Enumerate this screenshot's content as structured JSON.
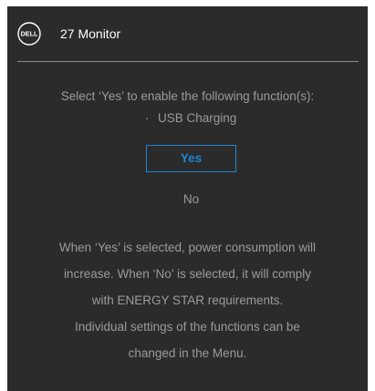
{
  "header": {
    "logo_text": "DELL",
    "title": "27 Monitor"
  },
  "prompt": {
    "text": "Select ‘Yes’ to enable the following function(s):"
  },
  "functions": [
    {
      "bullet": "·",
      "label": "USB Charging"
    }
  ],
  "buttons": {
    "yes_label": "Yes",
    "no_label": "No",
    "selected": "Yes"
  },
  "info": {
    "lines": [
      "When ‘Yes’ is selected, power consumption will",
      "increase. When ‘No’ is selected, it will comply",
      "with ENERGY STAR requirements.",
      "Individual settings of the functions can be",
      "changed in the Menu."
    ]
  },
  "colors": {
    "background": "#2b2b2b",
    "accent": "#1e86d3",
    "text_dim": "#9b9b9b",
    "text_bright": "#ffffff"
  }
}
